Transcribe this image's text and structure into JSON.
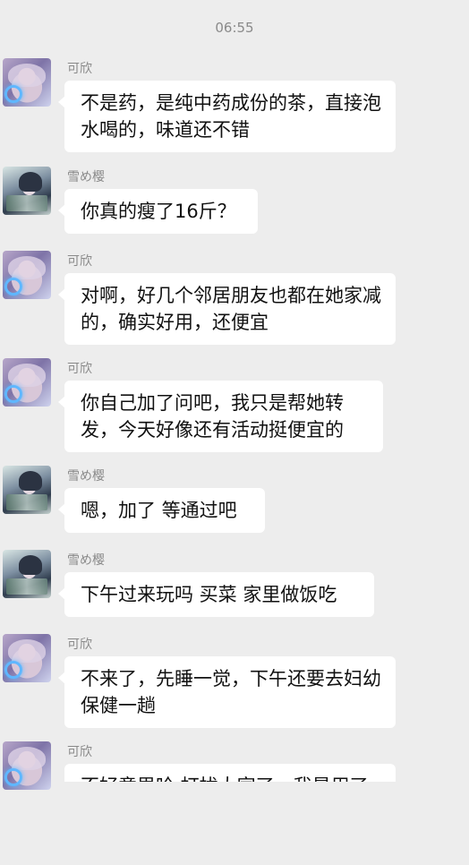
{
  "timestamp": "06:55",
  "messages": [
    {
      "sender": "可欣",
      "text": "不是药，是纯中药成份的茶，直接泡水喝的，味道还不错"
    },
    {
      "sender": "雪め樱",
      "text": "你真的瘦了16斤？"
    },
    {
      "sender": "可欣",
      "text": "对啊，好几个邻居朋友也都在她家减的，确实好用，还便宜"
    },
    {
      "sender": "可欣",
      "text": "你自己加了问吧，我只是帮她转发，今天好像还有活动挺便宜的"
    },
    {
      "sender": "雪め樱",
      "text": "嗯，加了 等通过吧"
    },
    {
      "sender": "雪め樱",
      "text": "下午过来玩吗 买菜 家里做饭吃"
    },
    {
      "sender": "可欣",
      "text": "不来了，先睡一觉，下午还要去妇幼保健一趟"
    },
    {
      "sender": "可欣",
      "text": "不好意思哈 打扰大家了，我是用了瘦下来 没反弹 她说帮她推荐一下我就转发了 下次不会了，对不起啊"
    }
  ]
}
